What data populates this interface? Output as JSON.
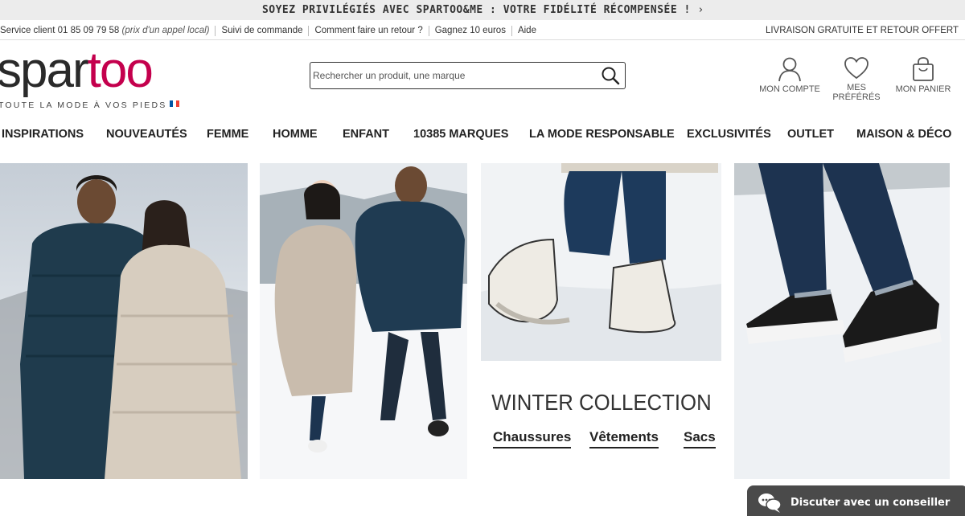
{
  "promo": {
    "text": "SOYEZ PRIVILÉGIÉS AVEC SPARTOO&ME : VOTRE FIDÉLITÉ RÉCOMPENSÉE !",
    "chevron": "›"
  },
  "utility": {
    "service_label": "Service client 01 85 09 79 58",
    "service_note": "(prix d'un appel local)",
    "links": [
      "Suivi de commande",
      "Comment faire un retour ?",
      "Gagnez 10 euros",
      "Aide"
    ],
    "right_text": "LIVRAISON GRATUITE ET RETOUR OFFERT"
  },
  "header": {
    "logo_part1": "spar",
    "logo_part2": "too",
    "tagline": "TOUTE LA MODE À VOS PIEDS",
    "search_placeholder": "Rechercher un produit, une marque",
    "account_label": "MON COMPTE",
    "favorites_label": "MES PRÉFÉRÉS",
    "cart_label": "MON PANIER"
  },
  "nav": {
    "items": [
      "INSPIRATIONS",
      "NOUVEAUTÉS",
      "FEMME",
      "HOMME",
      "ENFANT",
      "10385 MARQUES",
      "LA MODE RESPONSABLE",
      "EXCLUSIVITÉS",
      "OUTLET",
      "MAISON & DÉCO"
    ]
  },
  "collection": {
    "title": "WINTER COLLECTION",
    "links": [
      "Chaussures",
      "Vêtements",
      "Sacs"
    ]
  },
  "chat": {
    "label": "Discuter avec un conseiller"
  },
  "colors": {
    "brand": "#c4004d",
    "text": "#222222",
    "promo_bg": "#ececec",
    "chat_bg": "#4a4a4a"
  },
  "icons": [
    "search-icon",
    "user-icon",
    "heart-icon",
    "bag-icon",
    "chat-bubbles-icon",
    "chevron-right-icon",
    "france-flag-icon"
  ]
}
